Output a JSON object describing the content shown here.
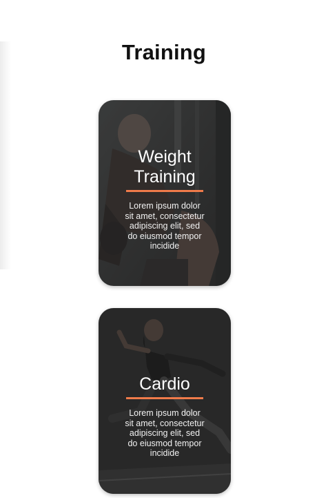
{
  "page": {
    "title": "Training"
  },
  "cards": [
    {
      "title": "Weight Training",
      "description": "Lorem ipsum dolor sit amet, consectetur adipiscing elit, sed do eiusmod tempor incidide",
      "photo_icon": "weightlifting-photo"
    },
    {
      "title": "Cardio",
      "description": "Lorem ipsum dolor sit amet, consectetur adipiscing elit, sed do eiusmod tempor incidide",
      "photo_icon": "running-photo"
    }
  ],
  "colors": {
    "accent": "#f07b4a",
    "card_overlay": "#2a2a2a",
    "title_text": "#111111"
  }
}
